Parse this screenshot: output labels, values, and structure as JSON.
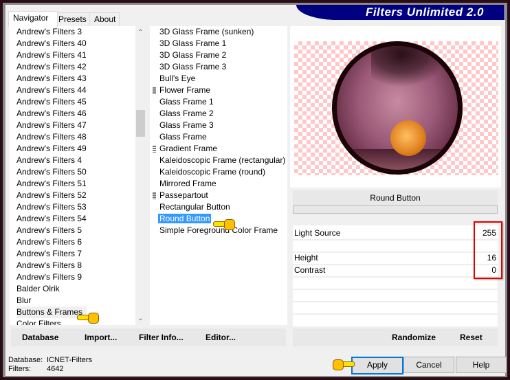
{
  "app": {
    "title": "Filters Unlimited 2.0"
  },
  "tabs": [
    {
      "label": "Navigator",
      "active": true
    },
    {
      "label": "Presets",
      "active": false
    },
    {
      "label": "About",
      "active": false
    }
  ],
  "categories": {
    "items": [
      "Andrew's Filters 3",
      "Andrew's Filters 40",
      "Andrew's Filters 41",
      "Andrew's Filters 42",
      "Andrew's Filters 43",
      "Andrew's Filters 44",
      "Andrew's Filters 45",
      "Andrew's Filters 46",
      "Andrew's Filters 47",
      "Andrew's Filters 48",
      "Andrew's Filters 49",
      "Andrew's Filters 4",
      "Andrew's Filters 50",
      "Andrew's Filters 51",
      "Andrew's Filters 52",
      "Andrew's Filters 53",
      "Andrew's Filters 54",
      "Andrew's Filters 5",
      "Andrew's Filters 6",
      "Andrew's Filters 7",
      "Andrew's Filters 8",
      "Andrew's Filters 9",
      "Balder Olrik",
      "Blur",
      "Buttons & Frames",
      "Color Filters"
    ],
    "selected": "Buttons & Frames"
  },
  "filters": {
    "items": [
      {
        "label": "3D Glass Frame (sunken)",
        "marked": false
      },
      {
        "label": "3D Glass Frame 1",
        "marked": false
      },
      {
        "label": "3D Glass Frame 2",
        "marked": false
      },
      {
        "label": "3D Glass Frame 3",
        "marked": false
      },
      {
        "label": "Bull's Eye",
        "marked": false
      },
      {
        "label": "Flower Frame",
        "marked": true
      },
      {
        "label": "Glass Frame 1",
        "marked": false
      },
      {
        "label": "Glass Frame 2",
        "marked": false
      },
      {
        "label": "Glass Frame 3",
        "marked": false
      },
      {
        "label": "Glass Frame",
        "marked": false
      },
      {
        "label": "Gradient Frame",
        "marked": true
      },
      {
        "label": "Kaleidoscopic Frame (rectangular)",
        "marked": false
      },
      {
        "label": "Kaleidoscopic Frame (round)",
        "marked": false
      },
      {
        "label": "Mirrored Frame",
        "marked": false
      },
      {
        "label": "Passepartout",
        "marked": true
      },
      {
        "label": "Rectangular Button",
        "marked": false
      },
      {
        "label": "Round Button",
        "marked": false
      },
      {
        "label": "Simple Foreground Color Frame",
        "marked": false
      }
    ],
    "selected": "Round Button"
  },
  "preview": {
    "filter_name": "Round Button"
  },
  "params": [
    {
      "label": "Light Source",
      "value": "255"
    },
    {
      "label": "",
      "value": ""
    },
    {
      "label": "Height",
      "value": "16"
    },
    {
      "label": "Contrast",
      "value": "0"
    },
    {
      "label": "",
      "value": ""
    },
    {
      "label": "",
      "value": ""
    },
    {
      "label": "",
      "value": ""
    }
  ],
  "left_buttons": {
    "database": "Database",
    "import": "Import...",
    "filter_info": "Filter Info...",
    "editor": "Editor..."
  },
  "right_buttons": {
    "randomize": "Randomize",
    "reset": "Reset"
  },
  "status": {
    "database_label": "Database:",
    "database_value": "ICNET-Filters",
    "filters_label": "Filters:",
    "filters_value": "4642"
  },
  "dialog_buttons": {
    "apply": "Apply",
    "cancel": "Cancel",
    "help": "Help"
  }
}
